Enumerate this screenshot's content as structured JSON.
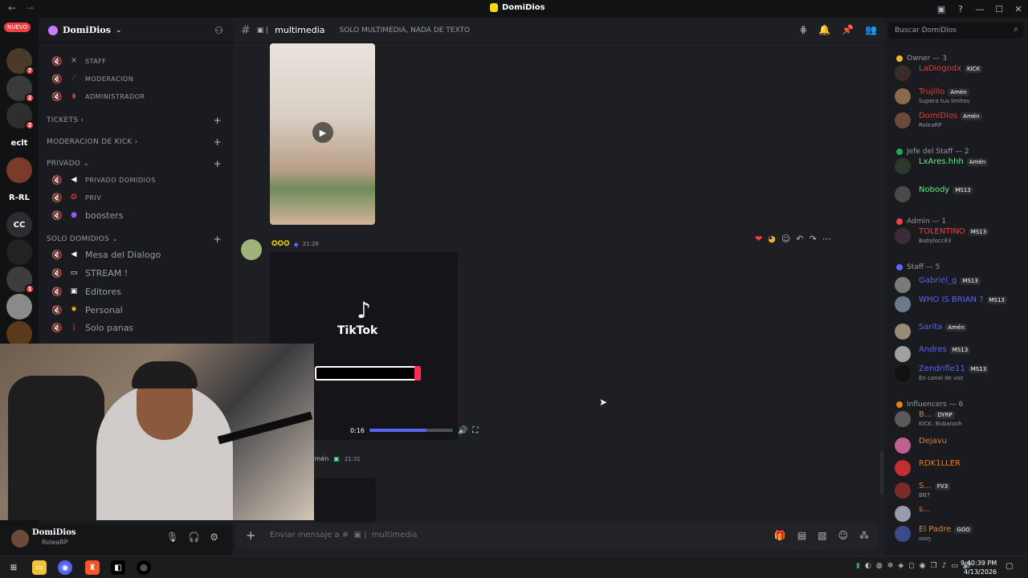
{
  "window": {
    "title": "DomiDios"
  },
  "rail": {
    "new_badge": "NUEVO",
    "labels": [
      "eclt",
      "R-RL",
      "CC"
    ],
    "badges": [
      "7",
      "2",
      "2",
      "1"
    ]
  },
  "server": {
    "name": "DomiDios"
  },
  "channels": {
    "top": [
      {
        "name": "STAFF"
      },
      {
        "name": "MODERACION"
      },
      {
        "name": "ADMINISTRADOR"
      }
    ],
    "categories": [
      {
        "name": "TICKETS"
      },
      {
        "name": "MODERACION DE KICK"
      },
      {
        "name": "PRIVADO"
      },
      {
        "name": "SOLO DOMIDIOS"
      }
    ],
    "privado": [
      {
        "name": "PRIVADO DOMIDIOS"
      },
      {
        "name": "PRIV"
      },
      {
        "name": "boosters"
      }
    ],
    "solo": [
      {
        "name": "Mesa del Dialogo"
      },
      {
        "name": "STREAM !"
      },
      {
        "name": "Editores"
      },
      {
        "name": "Personal"
      },
      {
        "name": "Solo panas"
      }
    ]
  },
  "user": {
    "name": "DomiDios",
    "status": "RoleaRP"
  },
  "chat": {
    "channel": "multimedia",
    "topic": "SOLO MULTIMEDIA, NADA DE TEXTO",
    "msg1_time": "21:26",
    "video_time": "0:16",
    "video_progress": 0.68,
    "tiktok_label": "TikTok",
    "msg2_name": "Amén",
    "msg2_time": "21:31",
    "composer_placeholder": "Enviar mensaje a #",
    "composer_channel": "multimedia"
  },
  "members": {
    "search_placeholder": "Buscar DomiDios",
    "roles": [
      {
        "name": "Owner — 3",
        "color": "#f0b232"
      },
      {
        "name": "Jefe del Staff — 2",
        "color": "#23a55a"
      },
      {
        "name": "Admin — 1",
        "color": "#f23f43"
      },
      {
        "name": "Staff — 5",
        "color": "#5865f2"
      },
      {
        "name": "Influencers — 6",
        "color": "#e67e22"
      }
    ],
    "list": [
      {
        "name": "LaDiogodx",
        "tag": "KICK",
        "status": "",
        "color": "#e03c3c"
      },
      {
        "name": "Trujillo",
        "tag": "Amén",
        "status": "Supera tus limites",
        "color": "#e03c3c"
      },
      {
        "name": "DomiDios",
        "tag": "Amén",
        "status": "RoleaRP",
        "color": "#e03c3c"
      },
      {
        "name": "LxAres.hhh",
        "tag": "Amén",
        "status": "",
        "color": "#57f287"
      },
      {
        "name": "Nobody",
        "tag": "MS13",
        "status": "",
        "color": "#57f287"
      },
      {
        "name": "TOLENTINO",
        "tag": "MS13",
        "status": "Babylocc83",
        "color": "#f23f43"
      },
      {
        "name": "Gabriel_g",
        "tag": "MS13",
        "status": "",
        "color": "#5865f2"
      },
      {
        "name": "WHO IS BRIAN ?",
        "tag": "MS13",
        "status": "",
        "color": "#5865f2"
      },
      {
        "name": "Sarita",
        "tag": "Amén",
        "status": "",
        "color": "#5865f2"
      },
      {
        "name": "Andres",
        "tag": "MS13",
        "status": "",
        "color": "#5865f2"
      },
      {
        "name": "Zendrifle11",
        "tag": "MS13",
        "status": "En canal de voz",
        "color": "#5865f2"
      },
      {
        "name": "B...",
        "tag": "DYRP",
        "status": "KICK: Bubalooh",
        "color": "#e67e22"
      },
      {
        "name": "Dejavu",
        "tag": "",
        "status": "",
        "color": "#e67e22"
      },
      {
        "name": "RDK1LLER",
        "tag": "",
        "status": "",
        "color": "#e67e22"
      },
      {
        "name": "S...",
        "tag": "FV3",
        "status": "BB7",
        "color": "#e67e22"
      },
      {
        "name": "s...",
        "tag": "",
        "status": "",
        "color": "#e67e22"
      },
      {
        "name": "El Padre",
        "tag": "GOO",
        "status": "ıooŋ",
        "color": "#e67e22"
      }
    ]
  },
  "taskbar": {
    "time": "9:40:39 PM",
    "date": "4/13/2026"
  }
}
